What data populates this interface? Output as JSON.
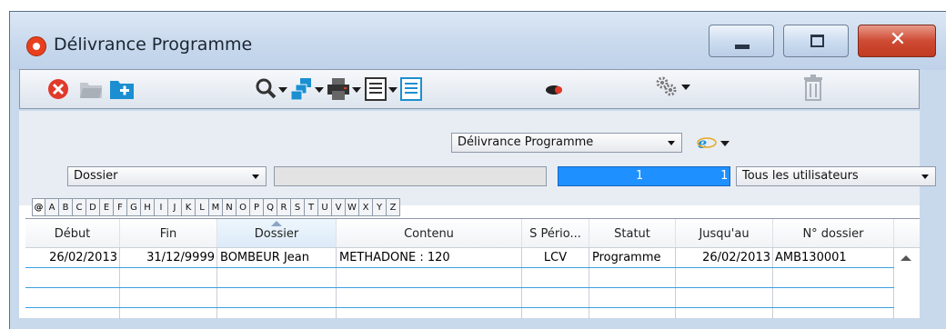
{
  "window": {
    "title": "Délivrance Programme",
    "close_glyph": "✕"
  },
  "toolbar": {
    "icons": [
      "delete-icon",
      "open-folder-icon",
      "new-folder-icon",
      "search-icon",
      "copy-icon",
      "print-icon",
      "list-icon",
      "list-blue-icon",
      "record-icon",
      "settings-icon",
      "trash-icon"
    ]
  },
  "filters": {
    "program_select": "Délivrance Programme",
    "field_select": "Dossier",
    "counter_from": "1",
    "counter_to": "1",
    "users_select": "Tous les utilisateurs"
  },
  "alphabet": [
    "@",
    "A",
    "B",
    "C",
    "D",
    "E",
    "F",
    "G",
    "H",
    "I",
    "J",
    "K",
    "L",
    "M",
    "N",
    "O",
    "P",
    "Q",
    "R",
    "S",
    "T",
    "U",
    "V",
    "W",
    "X",
    "Y",
    "Z"
  ],
  "table": {
    "columns": [
      "Début",
      "Fin",
      "Dossier",
      "Contenu",
      "S Pério...",
      "Statut",
      "Jusqu'au",
      "N° dossier"
    ],
    "rows": [
      [
        "26/02/2013",
        "31/12/9999",
        "BOMBEUR Jean",
        "METHADONE : 120",
        "LCV",
        "Programme",
        "26/02/2013",
        "AMB130001"
      ]
    ]
  },
  "colors": {
    "counter_bg": "#1e90ff",
    "row_line": "#3ca0e0",
    "close_btn": "#c13a22"
  }
}
